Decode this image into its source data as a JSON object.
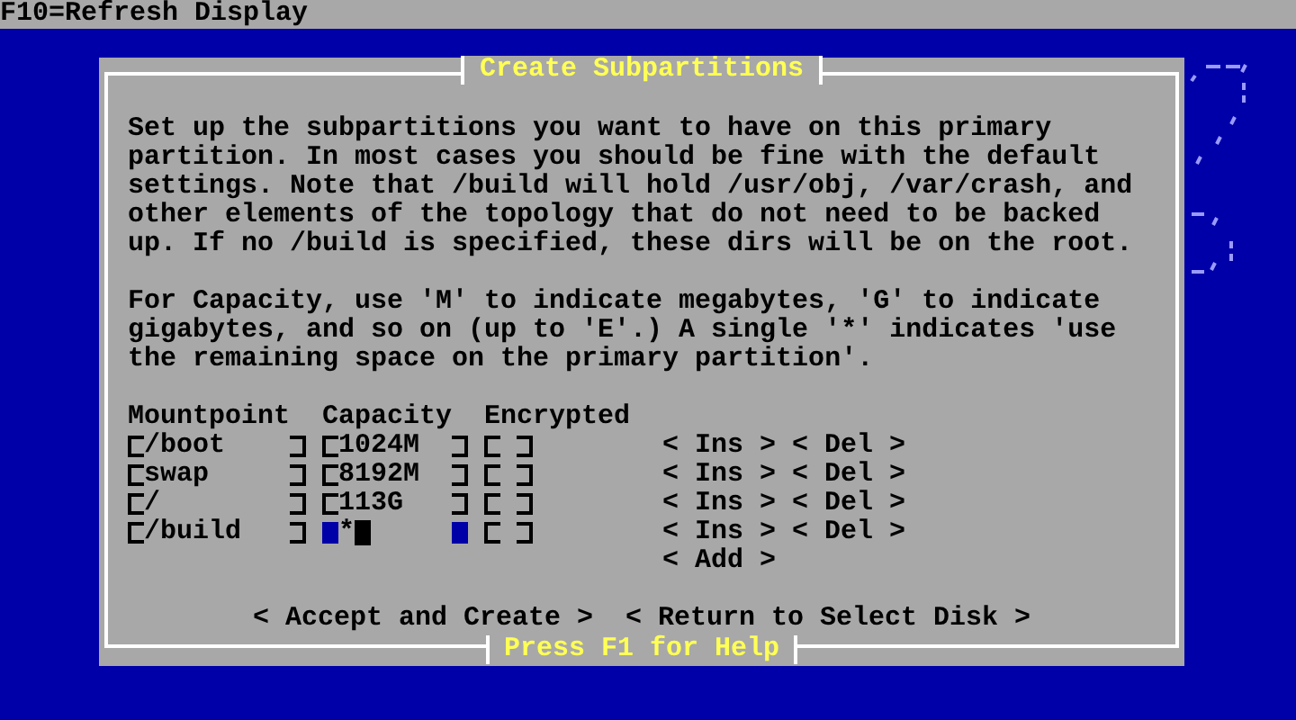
{
  "top_bar": {
    "text": "F10=Refresh Display"
  },
  "dialog": {
    "title": "Create Subpartitions",
    "paragraphs": [
      "Set up the subpartitions you want to have on this primary partition. In most cases you should be fine with the default settings. Note that /build will hold /usr/obj, /var/crash, and other elements of the topology that do not need to be backed up. If no /build is specified, these dirs will be on the root.",
      "For Capacity, use 'M' to indicate megabytes, 'G' to indicate gigabytes, and so on (up to 'E'.) A single '*' indicates 'use the remaining space on the primary partition'."
    ],
    "columns": [
      "Mountpoint",
      "Capacity",
      "Encrypted"
    ],
    "rows": [
      {
        "mountpoint": "/boot",
        "capacity": "1024M",
        "encrypted": false,
        "focused": false,
        "insert": "< Ins >",
        "delete": "< Del >"
      },
      {
        "mountpoint": "swap",
        "capacity": "8192M",
        "encrypted": false,
        "focused": false,
        "insert": "< Ins >",
        "delete": "< Del >"
      },
      {
        "mountpoint": "/",
        "capacity": "113G",
        "encrypted": false,
        "focused": false,
        "insert": "< Ins >",
        "delete": "< Del >"
      },
      {
        "mountpoint": "/build",
        "capacity": "*",
        "encrypted": false,
        "focused": true,
        "insert": "< Ins >",
        "delete": "< Del >"
      }
    ],
    "add_button": "< Add >",
    "buttons": [
      "< Accept and Create >",
      "< Return to Select Disk >"
    ],
    "help": "Press F1 for Help"
  }
}
